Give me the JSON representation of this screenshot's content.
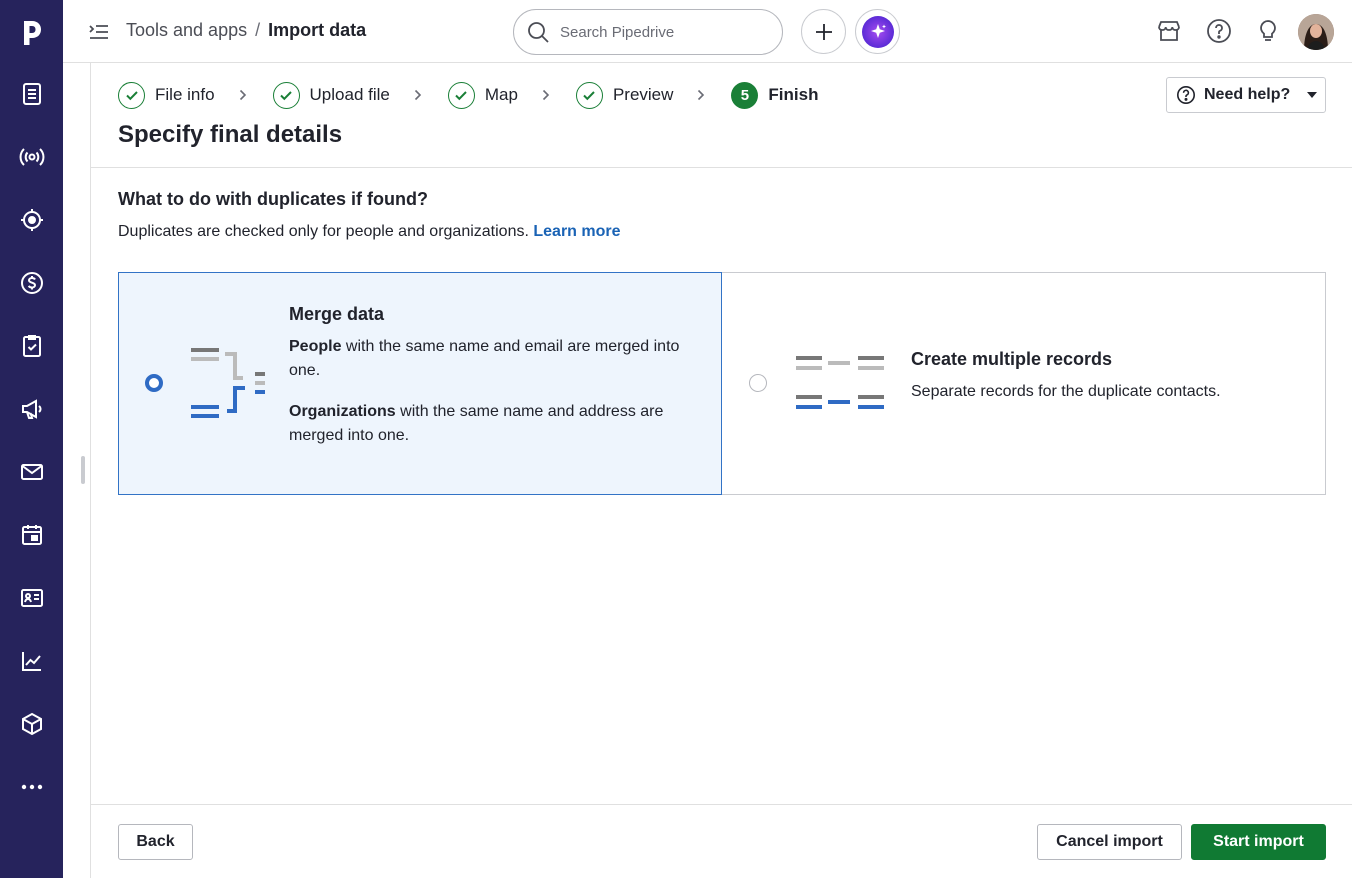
{
  "header": {
    "breadcrumb_parent": "Tools and apps",
    "breadcrumb_separator": "/",
    "breadcrumb_current": "Import data",
    "search_placeholder": "Search Pipedrive"
  },
  "sidebar": {
    "items": [
      {
        "icon": "leads-icon"
      },
      {
        "icon": "campaigns-broadcast-icon"
      },
      {
        "icon": "target-icon"
      },
      {
        "icon": "deals-dollar-icon"
      },
      {
        "icon": "activities-clipboard-icon"
      },
      {
        "icon": "megaphone-icon"
      },
      {
        "icon": "mail-icon"
      },
      {
        "icon": "calendar-icon"
      },
      {
        "icon": "contacts-card-icon"
      },
      {
        "icon": "insights-chart-icon"
      },
      {
        "icon": "products-box-icon"
      },
      {
        "icon": "more-icon"
      }
    ]
  },
  "stepper": {
    "steps": [
      {
        "label": "File info",
        "state": "done"
      },
      {
        "label": "Upload file",
        "state": "done"
      },
      {
        "label": "Map",
        "state": "done"
      },
      {
        "label": "Preview",
        "state": "done"
      },
      {
        "label": "Finish",
        "state": "active",
        "number": "5"
      }
    ]
  },
  "help_button": "Need help?",
  "page_title": "Specify final details",
  "duplicates": {
    "question": "What to do with duplicates if found?",
    "description": "Duplicates are checked only for people and organizations.",
    "learn_more": "Learn more"
  },
  "options": {
    "merge": {
      "title": "Merge data",
      "people_bold": "People",
      "people_text": " with the same name and email are merged into one.",
      "orgs_bold": "Organizations",
      "orgs_text": " with the same name and address are merged into one.",
      "selected": true
    },
    "multiple": {
      "title": "Create multiple records",
      "text": "Separate records for the duplicate contacts.",
      "selected": false
    }
  },
  "footer": {
    "back": "Back",
    "cancel": "Cancel import",
    "start": "Start import"
  },
  "colors": {
    "sidebar": "#26235c",
    "success_green": "#1a7f37",
    "primary_button": "#107a33",
    "selected_blue": "#2f6bc4",
    "link": "#1a63b5"
  }
}
